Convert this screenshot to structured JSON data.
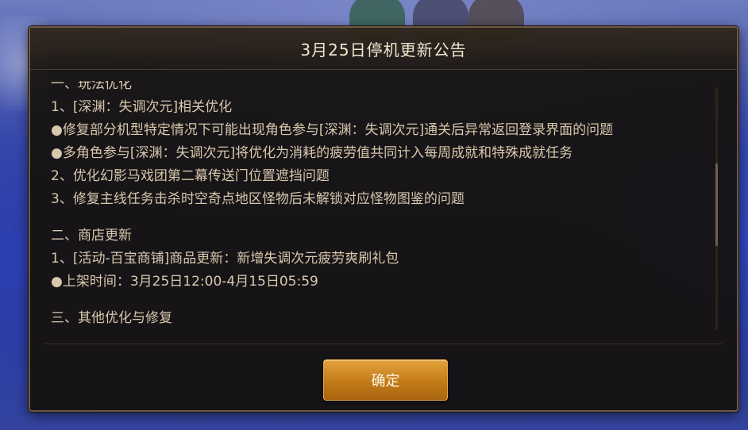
{
  "dialog": {
    "title": "3月25日停机更新公告",
    "confirm_label": "确定"
  },
  "content": {
    "lines": [
      "一、玩法优化",
      "1、[深渊：失调次元]相关优化",
      "●修复部分机型特定情况下可能出现角色参与[深渊：失调次元]通关后异常返回登录界面的问题",
      "●多角色参与[深渊：失调次元]将优化为消耗的疲劳值共同计入每周成就和特殊成就任务",
      "2、优化幻影马戏团第二幕传送门位置遮挡问题",
      "3、修复主线任务击杀时空奇点地区怪物后未解锁对应怪物图鉴的问题",
      "二、商店更新",
      "1、[活动-百宝商铺]商品更新：新增失调次元疲劳爽刷礼包",
      "●上架时间：3月25日12:00-4月15日05:59",
      "三、其他优化与修复"
    ]
  },
  "colors": {
    "dialog_bg": "#16110d",
    "border": "#6b5a44",
    "text": "#d8c8ac",
    "title": "#f2e6cf",
    "button": "#c27a18"
  }
}
